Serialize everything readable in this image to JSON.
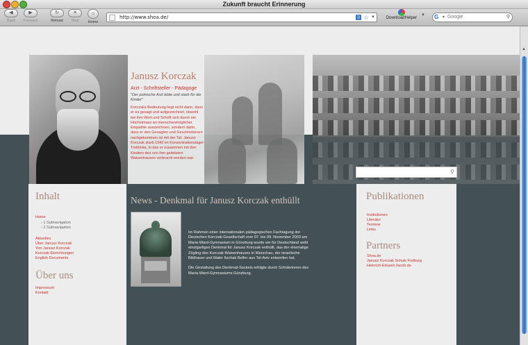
{
  "window": {
    "title": "Zukunft braucht Erinnerung"
  },
  "toolbar": {
    "back": "Back",
    "forward": "Forward",
    "reload": "Reload",
    "stop": "Stop",
    "home": "Home",
    "url": "http://www.shoa.de/",
    "downloadhelper": "DownloadHelper",
    "search_placeholder": "Google"
  },
  "icons": {
    "back": "left-arrow",
    "forward": "right-arrow",
    "reload": "circular-arrow",
    "stop": "x-mark",
    "home": "house",
    "rss": "rss-feed",
    "bookmark": "star",
    "search": "magnifier"
  },
  "colors": {
    "accent_red": "#c4302b",
    "heading_rose": "#a88a7e",
    "band_dark": "#435157"
  },
  "intro": {
    "name": "Janusz Korczak",
    "subtitle": "Arzt - Schriftsteller - Pädagoge",
    "quote": "\"Der polnische Arzt lebte und starb für die Kinder\"",
    "body": "Korczaks Bedeutung liegt nicht darin, dass er es gesagt und aufgezeichnet, obwohl bei ihm Wort und Schrift sich durch ein Höchstmass an menschenmöglicher Empathie auszeichnen, sondern darin, dass er den Gesagten und Geschriebenen nachgekommen ist mit der Tat. Janusz Korczak starb 1942 im Konzentrationslager Treblinka, in das er zusammen mit den Kindern des von ihm geleiteten Waisenhauses verbracht worden war."
  },
  "nav": {
    "inhalt_title": "Inhalt",
    "home": "Home",
    "sub1": "› 1 Subnavigation",
    "sub2": "› 2 Subnavigation",
    "items": [
      "Aktuelles",
      "Über Janusz Korczak",
      "Von Janusz Korczak",
      "Korczak Einrichtungen",
      "English Documents"
    ],
    "ueber_title": "Über uns",
    "ueber_items": [
      "Impressum",
      "Kontakt"
    ]
  },
  "news": {
    "title": "News - Denkmal für Janusz Korczak enthüllt",
    "p1": "Im Rahmen einer internationalen pädagogischen Fachtagung der Deutschen Korczak-Gesellschaft vom 07. bis 09. November 2003 am Maria-Ward-Gymnasium in Günzburg wurde ein für Deutschland wohl einzigartiges Denkmal für Janusz Korczak enthüllt, das der ehemalige Zögling des Korczak-Waisenhauses in Warschau, der israelische Bildhauer und Maler Itzchak Belfer aus Tel-Aviv entworfen hat.",
    "p2": "Die Gestaltung des Denkmal-Sockels erfolgte durch Schülerinnen des Maria-Ward-Gymnasiums Günzburg."
  },
  "publikationen": {
    "title": "Publikationen",
    "items": [
      "Institutionen",
      "Literatur",
      "Termine",
      "Links"
    ]
  },
  "partners": {
    "title": "Partners",
    "items": [
      "Shoa.de",
      "Janusz Korczak Schule Freiburg",
      "Heinrich-Eduard-Jacob.de"
    ]
  }
}
